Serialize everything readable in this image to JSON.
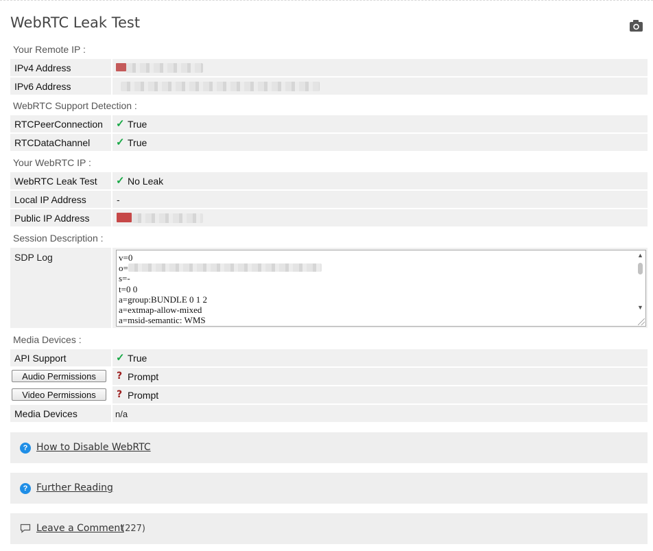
{
  "page": {
    "title": "WebRTC Leak Test",
    "camera_icon": "camera-icon"
  },
  "remote_ip": {
    "heading": "Your Remote IP :",
    "ipv4_label": "IPv4 Address",
    "ipv6_label": "IPv6 Address"
  },
  "support": {
    "heading": "WebRTC Support Detection :",
    "rows": [
      {
        "label": "RTCPeerConnection",
        "value": "True"
      },
      {
        "label": "RTCDataChannel",
        "value": "True"
      }
    ]
  },
  "webrtc_ip": {
    "heading": "Your WebRTC IP :",
    "leak_label": "WebRTC Leak Test",
    "leak_value": "No Leak",
    "local_label": "Local IP Address",
    "local_value": "-",
    "public_label": "Public IP Address"
  },
  "session": {
    "heading": "Session Description :",
    "sdp_label": "SDP Log",
    "sdp_lines": [
      "v=0",
      "o=",
      "s=-",
      "t=0 0",
      "a=group:BUNDLE 0 1 2",
      "a=extmap-allow-mixed",
      "a=msid-semantic: WMS"
    ]
  },
  "media": {
    "heading": "Media Devices :",
    "api_label": "API Support",
    "api_value": "True",
    "audio_button": "Audio Permissions",
    "audio_value": "Prompt",
    "video_button": "Video Permissions",
    "video_value": "Prompt",
    "devices_label": "Media Devices",
    "devices_value": "n/a"
  },
  "panels": {
    "disable_link": "How to Disable WebRTC",
    "reading_link": "Further Reading",
    "comment_link": "Leave a Comment",
    "comment_count": "(227)"
  },
  "colors": {
    "check": "#17a845",
    "question": "#9b1c1c",
    "info_icon": "#1f8ee6",
    "row_bg": "#f0f0f0"
  }
}
